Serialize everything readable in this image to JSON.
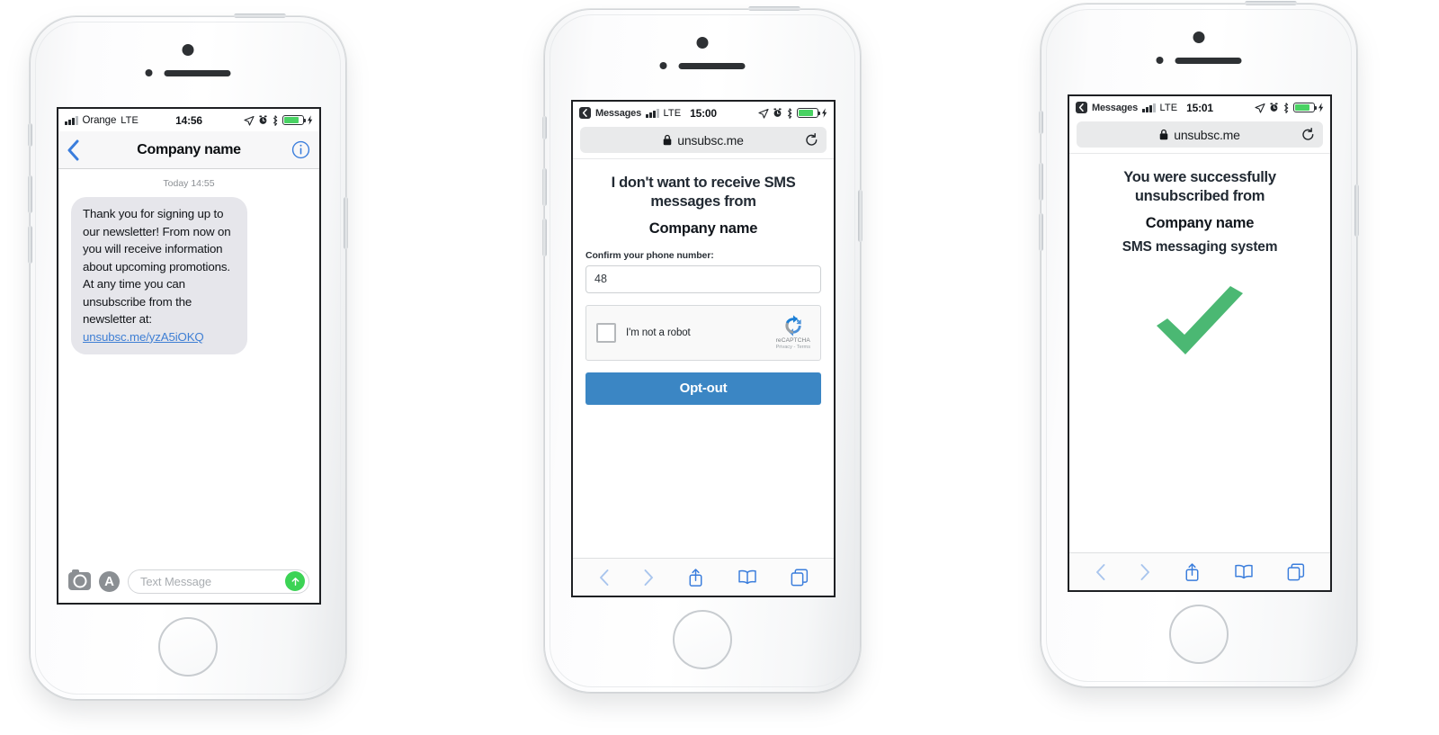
{
  "colors": {
    "ios_blue": "#3a7ddc",
    "link_blue": "#3f7fd4",
    "button_blue": "#3b86c4",
    "success_green": "#4BB873",
    "send_green": "#3cd355",
    "battery_green": "#49d263",
    "bubble_grey": "#e6e6eb"
  },
  "phone1": {
    "status": {
      "signal_icon": "signal-bars-icon",
      "carrier": "Orange",
      "network": "LTE",
      "time": "14:56",
      "location_icon": "location-arrow-icon",
      "alarm_icon": "alarm-clock-icon",
      "bluetooth_icon": "bluetooth-icon",
      "battery_icon": "battery-icon",
      "charging_icon": "charging-bolt-icon"
    },
    "navbar": {
      "back_icon": "chevron-left-icon",
      "title": "Company name",
      "info_icon": "info-circle-icon"
    },
    "conversation": {
      "timestamp": "Today 14:55",
      "message_text": "Thank you for signing up to our newsletter! From now on you will receive information about upcoming promotions. At any time you can unsubscribe from the newsletter at: ",
      "message_link": "unsubsc.me/yzA5iOKQ"
    },
    "inputbar": {
      "camera_icon": "camera-icon",
      "appstore_icon": "app-store-icon",
      "placeholder": "Text Message",
      "send_icon": "send-arrow-up-icon"
    }
  },
  "phone2": {
    "status": {
      "back_app": "Messages",
      "back_icon": "back-badge-icon",
      "signal_icon": "signal-bars-icon",
      "network": "LTE",
      "time": "15:00",
      "location_icon": "location-arrow-icon",
      "alarm_icon": "alarm-clock-icon",
      "bluetooth_icon": "bluetooth-icon",
      "battery_icon": "battery-icon",
      "charging_icon": "charging-bolt-icon"
    },
    "urlbar": {
      "lock_icon": "lock-icon",
      "url": "unsubsc.me",
      "reload_icon": "reload-icon"
    },
    "page": {
      "heading": "I don't want to receive SMS messages from",
      "company": "Company name",
      "field_label": "Confirm your phone number:",
      "phone_value": "48",
      "recaptcha_label": "I'm not a robot",
      "recaptcha_brand": "reCAPTCHA",
      "recaptcha_terms": "Privacy - Terms",
      "recaptcha_logo_icon": "recaptcha-logo-icon",
      "checkbox_icon": "checkbox-unchecked-icon",
      "submit_label": "Opt-out"
    },
    "toolbar": {
      "back_icon": "chevron-left-icon",
      "forward_icon": "chevron-right-icon",
      "share_icon": "share-icon",
      "bookmarks_icon": "book-icon",
      "tabs_icon": "tabs-icon"
    }
  },
  "phone3": {
    "status": {
      "back_app": "Messages",
      "back_icon": "back-badge-icon",
      "signal_icon": "signal-bars-icon",
      "network": "LTE",
      "time": "15:01",
      "location_icon": "location-arrow-icon",
      "alarm_icon": "alarm-clock-icon",
      "bluetooth_icon": "bluetooth-icon",
      "battery_icon": "battery-icon",
      "charging_icon": "charging-bolt-icon"
    },
    "urlbar": {
      "lock_icon": "lock-icon",
      "url": "unsubsc.me",
      "reload_icon": "reload-icon"
    },
    "page": {
      "heading": "You were successfully unsubscribed from",
      "company": "Company name",
      "subtitle": "SMS messaging system",
      "success_icon": "green-checkmark-icon"
    },
    "toolbar": {
      "back_icon": "chevron-left-icon",
      "forward_icon": "chevron-right-icon",
      "share_icon": "share-icon",
      "bookmarks_icon": "book-icon",
      "tabs_icon": "tabs-icon"
    }
  }
}
